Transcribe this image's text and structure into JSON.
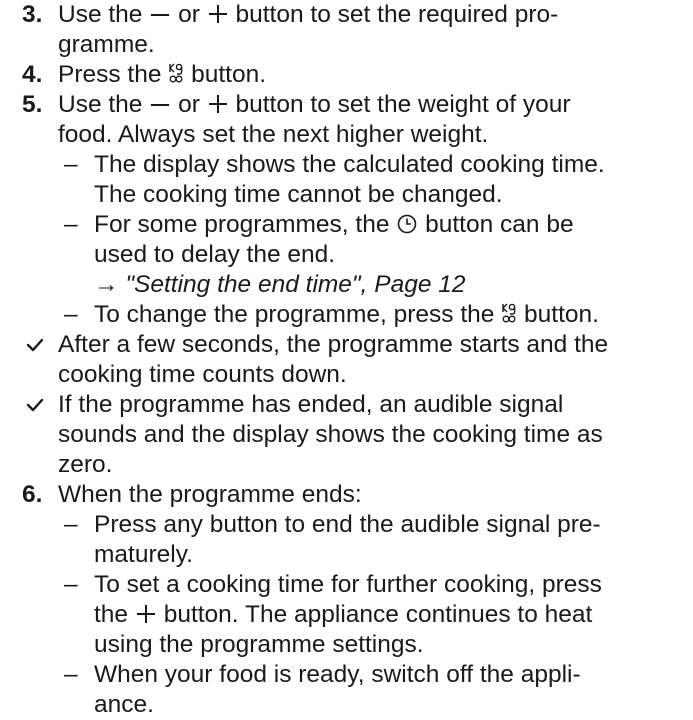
{
  "colors": {
    "text": "#1a1a1a",
    "accent": "#1a1a1a"
  },
  "icons": {
    "minus": "minus-icon",
    "plus": "plus-icon",
    "weight": "kg-weight-icon",
    "clock": "clock-icon",
    "check": "checkmark-icon"
  },
  "steps": {
    "s3": {
      "num": "3.",
      "a": "Use the",
      "b": "or",
      "c": "button to set the required pro-",
      "line2": "gramme."
    },
    "s4": {
      "num": "4.",
      "a": "Press the",
      "b": "button."
    },
    "s5": {
      "num": "5.",
      "a": "Use the",
      "b": "or",
      "c": "button to set the weight of your",
      "line2": "food. Always set the next higher weight.",
      "sub1": {
        "dash": "–",
        "line1": "The display shows the calculated cooking time.",
        "line2": "The cooking time cannot be changed."
      },
      "sub2": {
        "dash": "–",
        "a": "For some programmes, the",
        "b": "button can be",
        "line2": "used to delay the end.",
        "arrow": "→",
        "link": "\"Setting the end time\", Page 12"
      },
      "sub3": {
        "dash": "–",
        "a": "To change the programme, press the",
        "b": "button."
      }
    },
    "r1": {
      "line1": "After a few seconds, the programme starts and the",
      "line2": "cooking time counts down."
    },
    "r2": {
      "line1": "If the programme has ended, an audible signal",
      "line2": "sounds and the display shows the cooking time as",
      "line3": "zero."
    },
    "s6": {
      "num": "6.",
      "text": "When the programme ends:",
      "sub1": {
        "dash": "–",
        "line1": "Press any button to end the audible signal pre-",
        "line2": "maturely."
      },
      "sub2": {
        "dash": "–",
        "line1": "To set a cooking time for further cooking, press",
        "a": "the",
        "b": "button. The appliance continues to heat",
        "line3": "using the programme settings."
      },
      "sub3": {
        "dash": "–",
        "line1": "When your food is ready, switch off the appli-",
        "line2": "ance."
      }
    }
  }
}
